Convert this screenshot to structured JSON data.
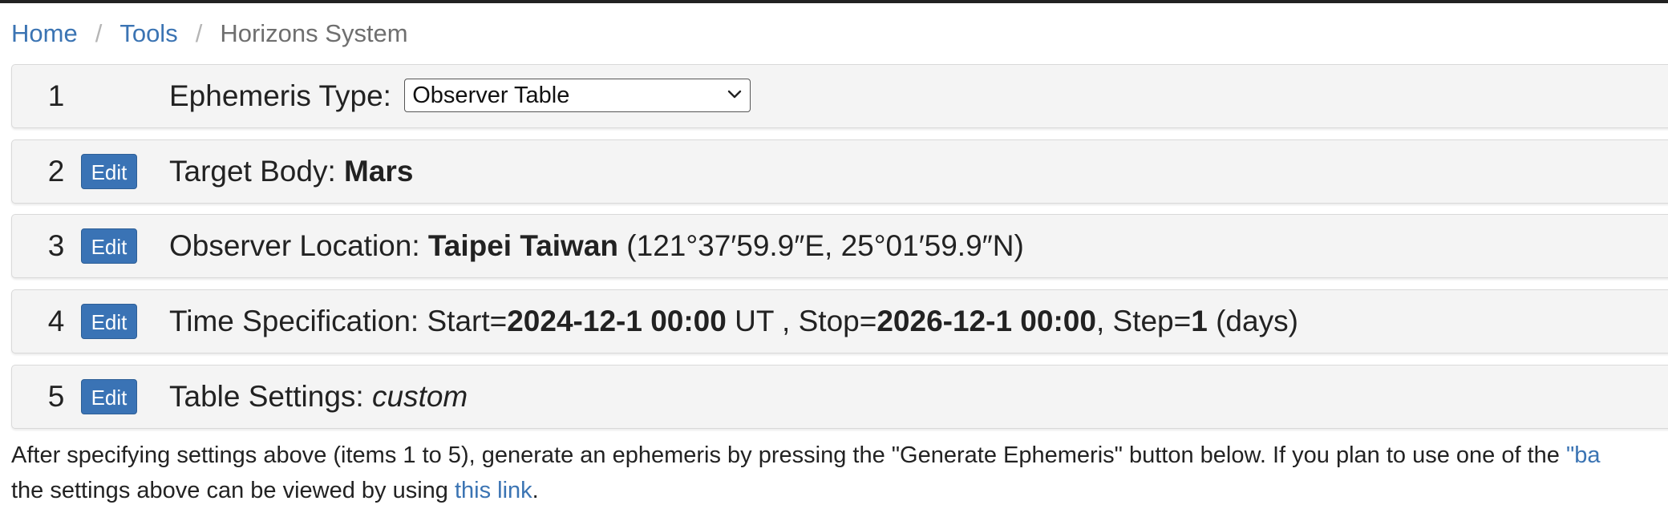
{
  "breadcrumb": {
    "home": "Home",
    "separator": "/",
    "tools": "Tools",
    "current": "Horizons System"
  },
  "steps": {
    "edit_label": "Edit",
    "ephemeris_type": {
      "number": "1",
      "label": "Ephemeris Type:",
      "selected": "Observer Table"
    },
    "target_body": {
      "number": "2",
      "label": "Target Body:",
      "value": "Mars"
    },
    "observer_location": {
      "number": "3",
      "label": "Observer Location:",
      "value": "Taipei Taiwan",
      "coords": "(121°37′59.9″E, 25°01′59.9″N)"
    },
    "time_spec": {
      "number": "4",
      "label": "Time Specification:",
      "start_prefix": "Start=",
      "start": "2024-12-1 00:00",
      "start_suffix": " UT , Stop=",
      "stop": "2026-12-1 00:00",
      "step_prefix": ", Step=",
      "step": "1",
      "step_unit": " (days)"
    },
    "table_settings": {
      "number": "5",
      "label": "Table Settings:",
      "value": "custom"
    }
  },
  "footer": {
    "line1": "After specifying settings above (items 1 to 5), generate an ephemeris by pressing the \"Generate Ephemeris\" button below. If you plan to use one of the ",
    "line1_link": "\"ba",
    "line2_prefix": "the settings above can be viewed by using ",
    "line2_link": "this link",
    "line2_suffix": "."
  },
  "colors": {
    "link": "#3b74b3",
    "edit_button": "#3a73b5",
    "panel_bg": "#f4f4f4"
  },
  "icons": {
    "select_chevron": "chevron-down-icon"
  }
}
